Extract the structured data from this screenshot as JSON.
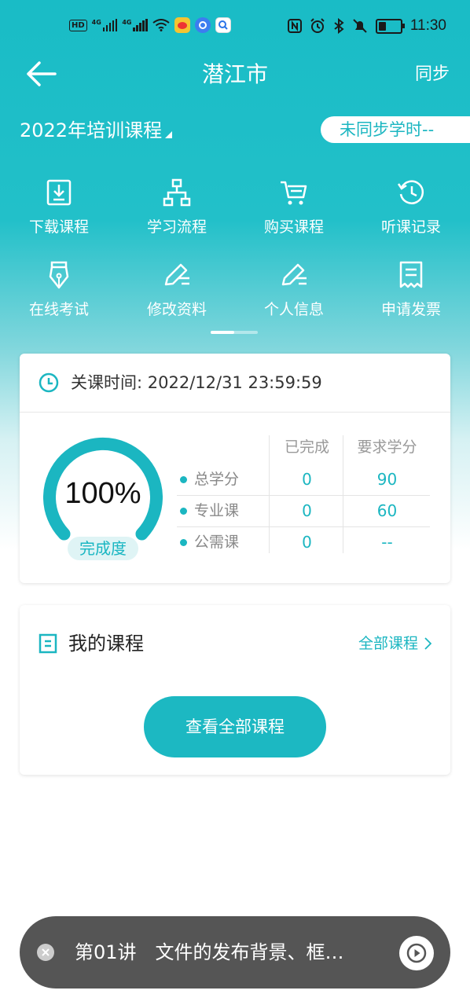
{
  "status_bar": {
    "time": "11:30",
    "left_indicators": [
      "HD",
      "4G",
      "4G"
    ],
    "icons": [
      "hd-icon",
      "signal-icon",
      "wifi-icon",
      "weibo-icon",
      "browser-icon",
      "search-app-icon",
      "nfc-icon",
      "alarm-icon",
      "bluetooth-icon",
      "mute-icon",
      "battery-icon"
    ]
  },
  "header": {
    "title": "潜江市",
    "back_icon": "back-arrow-icon",
    "sync_label": "同步"
  },
  "year_selector": {
    "label": "2022年培训课程"
  },
  "unsynced_badge": {
    "text": "未同步学时--"
  },
  "shortcuts": [
    {
      "label": "下载课程",
      "icon": "download-icon"
    },
    {
      "label": "学习流程",
      "icon": "flowchart-icon"
    },
    {
      "label": "购买课程",
      "icon": "cart-icon"
    },
    {
      "label": "听课记录",
      "icon": "history-icon"
    },
    {
      "label": "在线考试",
      "icon": "pen-nib-icon"
    },
    {
      "label": "修改资料",
      "icon": "edit-icon"
    },
    {
      "label": "个人信息",
      "icon": "edit-icon"
    },
    {
      "label": "申请发票",
      "icon": "invoice-icon"
    }
  ],
  "progress_card": {
    "close_time_label": "关课时间: 2022/12/31 23:59:59",
    "percent_text": "100%",
    "percent_value": 1.0,
    "completion_label": "完成度",
    "columns": [
      "已完成",
      "要求学分"
    ],
    "rows": [
      {
        "label": "总学分",
        "completed": "0",
        "required": "90"
      },
      {
        "label": "专业课",
        "completed": "0",
        "required": "60"
      },
      {
        "label": "公需课",
        "completed": "0",
        "required": "--"
      }
    ]
  },
  "my_courses": {
    "title": "我的课程",
    "all_link": "全部课程",
    "view_all_button": "查看全部课程"
  },
  "player": {
    "text": "第01讲　文件的发布背景、框…"
  },
  "colors": {
    "accent": "#1bb6c1",
    "header_bg": "#19bcc6",
    "player_bg": "#555555"
  }
}
